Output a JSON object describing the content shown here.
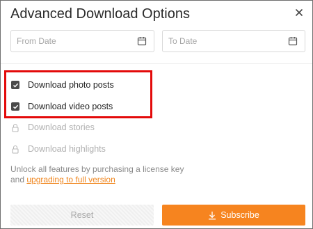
{
  "dialog": {
    "title": "Advanced Download Options"
  },
  "dates": {
    "from_placeholder": "From Date",
    "to_placeholder": "To Date"
  },
  "options": {
    "photo": "Download photo posts",
    "video": "Download video posts",
    "stories": "Download stories",
    "highlights": "Download highlights"
  },
  "note": {
    "line1": "Unlock all features by purchasing a license key",
    "line2_prefix": "and ",
    "link": "upgrading to full version"
  },
  "buttons": {
    "reset": "Reset",
    "subscribe": "Subscribe"
  },
  "colors": {
    "accent": "#f6841f",
    "highlight": "#e30a0a"
  },
  "icons": [
    "close-icon",
    "calendar-icon",
    "checkbox-checked-icon",
    "lock-icon",
    "download-icon"
  ]
}
